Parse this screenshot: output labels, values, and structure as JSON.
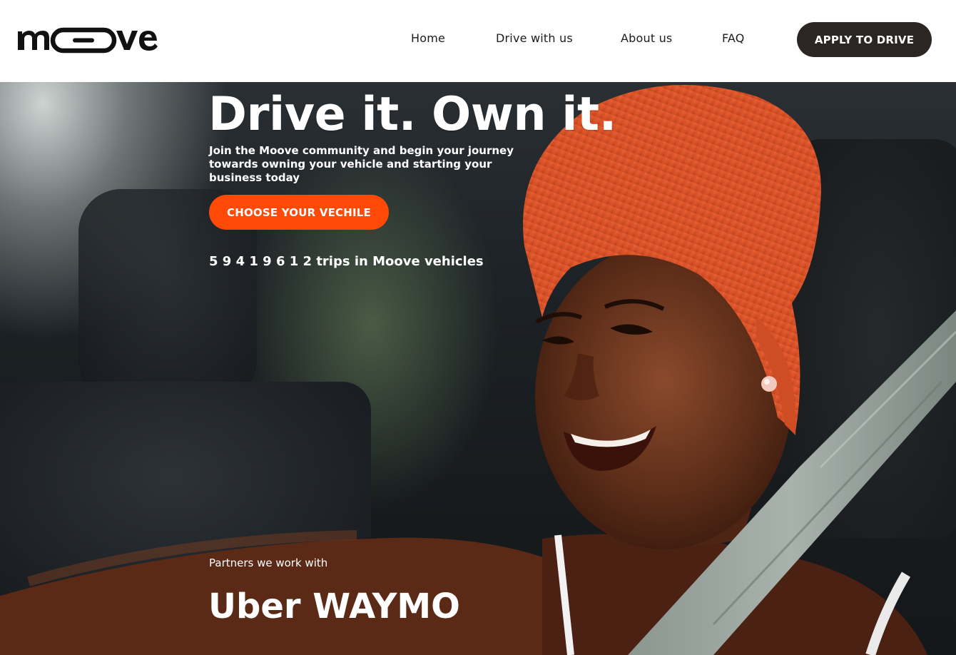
{
  "brand": {
    "name": "moove",
    "accent_color": "#fe4a06",
    "dark_color": "#2b2624"
  },
  "nav": {
    "items": [
      {
        "label": "Home"
      },
      {
        "label": "Drive with us"
      },
      {
        "label": "About us"
      },
      {
        "label": "FAQ"
      }
    ],
    "cta_label": "APPLY TO DRIVE"
  },
  "hero": {
    "title": "Drive it. Own it.",
    "subtitle": "Join the Moove community and begin your journey towards owning your vehicle and starting your business today",
    "cta_label": "CHOOSE YOUR VECHILE",
    "trips_text": "5 9 4 1 9 6 1 2 trips in Moove vehicles",
    "partners_label": "Partners we work with",
    "partners_text": "Uber WAYMO",
    "background_image": "smiling woman in orange head wrap driving a car, wearing a seatbelt"
  }
}
